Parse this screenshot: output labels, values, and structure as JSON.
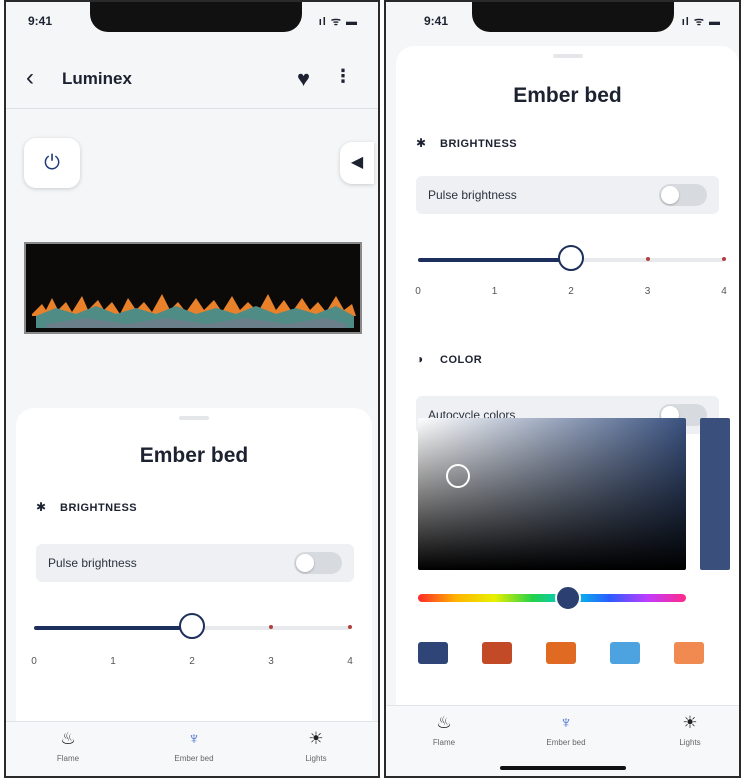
{
  "status": {
    "time": "9:41",
    "signal_icons": "ıl ᯤ ▬"
  },
  "header": {
    "back_icon": "‹",
    "title": "Luminex",
    "favorite_icon": "♥",
    "more_icon": "⋮"
  },
  "controls": {
    "power_icon": "⏻",
    "sound_icon": "◀"
  },
  "sheet": {
    "title": "Ember bed"
  },
  "brightness": {
    "section_label": "BRIGHTNESS",
    "section_icon": "✱",
    "pulse_label": "Pulse brightness",
    "pulse_on": false,
    "ticks": [
      "0",
      "1",
      "2",
      "3",
      "4"
    ],
    "min": 0,
    "max": 4,
    "value": 2
  },
  "color": {
    "section_label": "COLOR",
    "section_icon": "◑",
    "autocycle_label": "Autocycle colors",
    "autocycle_on": false,
    "picker": {
      "saturation": 0.15,
      "value": 0.62
    },
    "hue_fraction": 0.56,
    "brightness_bar_color": "#3a4f7c",
    "swatches": [
      "#2f4577",
      "#c24a26",
      "#e06a22",
      "#4da3e0",
      "#f08a50"
    ]
  },
  "tabs": [
    {
      "label": "Flame",
      "icon": "flame-icon",
      "glyph": "♨"
    },
    {
      "label": "Ember bed",
      "icon": "ember-bed-icon",
      "glyph": "♆",
      "active": true
    },
    {
      "label": "Lights",
      "icon": "lights-icon",
      "glyph": "☀"
    }
  ],
  "accent": "#1d2f5c"
}
